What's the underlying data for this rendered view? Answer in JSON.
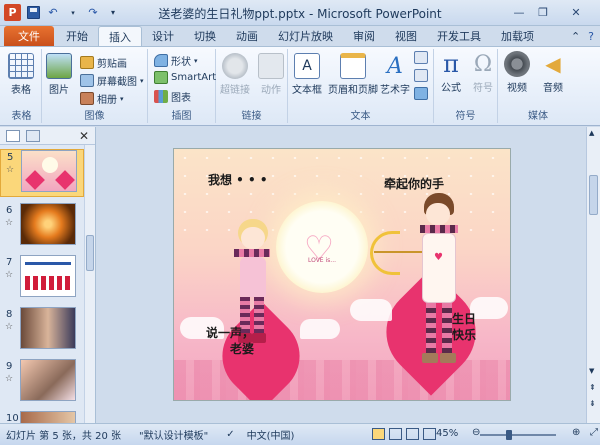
{
  "window": {
    "title": "送老婆的生日礼物ppt.pptx - Microsoft PowerPoint",
    "app_logo": "P"
  },
  "tabs": [
    {
      "label": "文件"
    },
    {
      "label": "开始"
    },
    {
      "label": "插入"
    },
    {
      "label": "设计"
    },
    {
      "label": "切换"
    },
    {
      "label": "动画"
    },
    {
      "label": "幻灯片放映"
    },
    {
      "label": "审阅"
    },
    {
      "label": "视图"
    },
    {
      "label": "开发工具"
    },
    {
      "label": "加载项"
    }
  ],
  "ribbon": {
    "groups": {
      "table": {
        "label": "表格",
        "btn": "表格"
      },
      "images": {
        "label": "图像",
        "picture": "图片",
        "clipart": "剪贴画",
        "screenshot": "屏幕截图",
        "album": "相册"
      },
      "illustrations": {
        "label": "插图",
        "shapes": "形状",
        "smartart": "SmartArt",
        "chart": "图表"
      },
      "links": {
        "label": "链接",
        "hyperlink": "超链接",
        "action": "动作"
      },
      "text": {
        "label": "文本",
        "textbox": "文本框",
        "headerfooter": "页眉和页脚",
        "wordart": "艺术字"
      },
      "symbols": {
        "label": "符号",
        "equation": "公式",
        "symbol": "符号"
      },
      "media": {
        "label": "媒体",
        "video": "视频",
        "audio": "音频"
      }
    }
  },
  "slides_panel": {
    "thumbnails": [
      {
        "num": "5"
      },
      {
        "num": "6"
      },
      {
        "num": "7"
      },
      {
        "num": "8"
      },
      {
        "num": "9"
      },
      {
        "num": "10"
      }
    ]
  },
  "slide": {
    "text_tl": "我想 • • •",
    "text_tr": "牵起你的手",
    "text_bl": "说一声，\n老婆",
    "text_br": "生日\n快乐",
    "moon_text": "LOVE is..."
  },
  "status": {
    "slide_info": "幻灯片 第 5 张，共 20 张",
    "theme": "\"默认设计模板\"",
    "language": "中文(中国)",
    "zoom": "45%"
  },
  "colors": {
    "file_tab": "#d5602a",
    "ribbon_bg": "#eef4fb",
    "slide_pink": "#f2a6c0",
    "heart": "#e8336e"
  }
}
